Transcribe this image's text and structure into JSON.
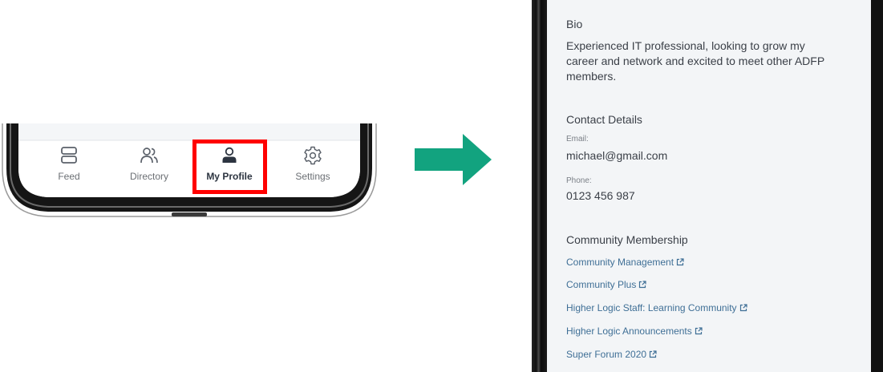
{
  "tabbar": {
    "tabs": [
      {
        "label": "Feed",
        "icon": "feed-icon"
      },
      {
        "label": "Directory",
        "icon": "people-icon"
      },
      {
        "label": "My Profile",
        "icon": "person-icon",
        "active": true
      },
      {
        "label": "Settings",
        "icon": "gear-icon"
      }
    ]
  },
  "colors": {
    "highlight": "#ff0000",
    "arrow": "#12a37f",
    "link": "#3f6f96",
    "screen_bg": "#f3f5f7"
  },
  "profile": {
    "bio_title": "Bio",
    "bio_text": "Experienced IT professional, looking to grow my career and network and excited to meet other ADFP members.",
    "contact_title": "Contact Details",
    "email_label": "Email:",
    "email_value": "michael@gmail.com",
    "phone_label": "Phone:",
    "phone_value": "0123 456 987",
    "membership_title": "Community Membership",
    "memberships": [
      "Community Management",
      "Community Plus",
      "Higher Logic Staff: Learning Community",
      "Higher Logic Announcements",
      "Super Forum 2020"
    ]
  }
}
